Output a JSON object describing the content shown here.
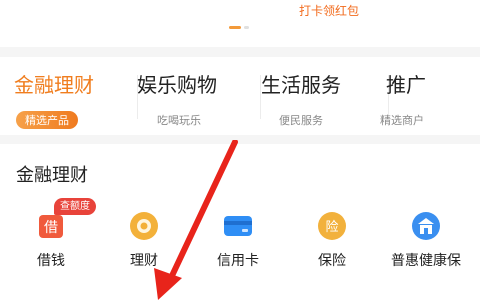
{
  "top": {
    "checkin_link": "打卡领红包"
  },
  "tabs": [
    {
      "title": "金融理财",
      "subtitle": "精选产品",
      "active": true
    },
    {
      "title": "娱乐购物",
      "subtitle": "吃喝玩乐",
      "active": false
    },
    {
      "title": "生活服务",
      "subtitle": "便民服务",
      "active": false
    },
    {
      "title": "推广",
      "subtitle": "精选商户",
      "active": false
    }
  ],
  "section": {
    "title": "金融理财",
    "items": [
      {
        "label": "借钱",
        "icon": "borrow-icon",
        "badge": "查额度"
      },
      {
        "label": "理财",
        "icon": "wealth-coin-icon"
      },
      {
        "label": "信用卡",
        "icon": "credit-card-icon"
      },
      {
        "label": "保险",
        "icon": "insurance-icon"
      },
      {
        "label": "普惠健康保",
        "icon": "health-insurance-icon"
      }
    ]
  },
  "colors": {
    "accent": "#f07d1e",
    "borrow_icon": "#f05a3c",
    "wealth_icon": "#f3b13a",
    "card_icon": "#2f8ef5",
    "insurance_icon": "#f2b13c",
    "health_icon": "#3a8ff0",
    "badge": "#e8433a",
    "arrow": "#e8241b"
  }
}
